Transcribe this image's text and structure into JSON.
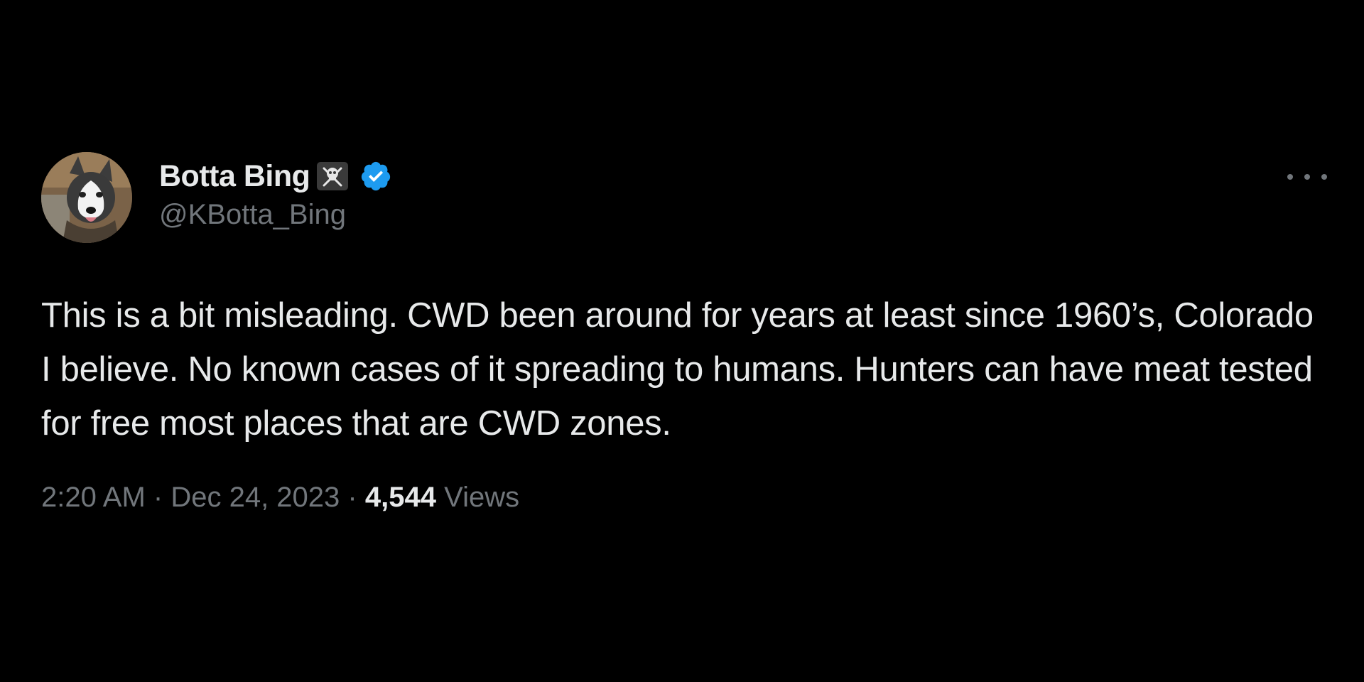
{
  "author": {
    "display_name": "Botta Bing",
    "handle": "@KBotta_Bing",
    "name_emoji": "skull-and-crossbones-icon",
    "verified_icon": "verified-badge-icon",
    "verified_color": "#1d9bf0"
  },
  "tweet": {
    "text": "This is a bit misleading. CWD been around for years at least since 1960’s, Colorado I believe. No known cases of it spreading to humans. Hunters can have meat tested for free most places that are CWD zones.",
    "time": "2:20 AM",
    "separator": "·",
    "date": "Dec 24, 2023",
    "views_count": "4,544",
    "views_label": "Views"
  },
  "more_menu_icon": "more-options-icon",
  "colors": {
    "background": "#000000",
    "primary_text": "#e7e9ea",
    "secondary_text": "#71767b"
  }
}
